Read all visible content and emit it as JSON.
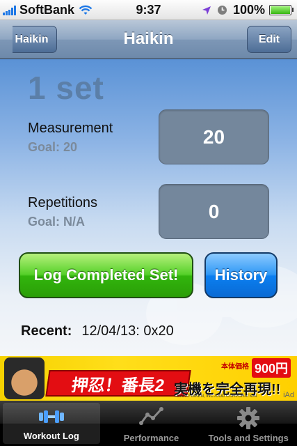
{
  "status_bar": {
    "carrier": "SoftBank",
    "time": "9:37",
    "battery": "100%"
  },
  "nav": {
    "back_label": "Haikin",
    "title": "Haikin",
    "edit_label": "Edit"
  },
  "workout": {
    "set_label": "1 set",
    "measurement": {
      "label": "Measurement",
      "goal": "Goal: 20",
      "value": "20"
    },
    "repetitions": {
      "label": "Repetitions",
      "goal": "Goal: N/A",
      "value": "0"
    },
    "log_button": "Log Completed Set!",
    "history_button": "History",
    "recent_label": "Recent:",
    "recent_value": "12/04/13: 0x20"
  },
  "ad": {
    "title": "押忍！番長2",
    "price_tag": "本体価格",
    "price": "900円",
    "subtitle": "実機を完全再現!!",
    "copyright": "©DAITO GIKEN, INC./DOD CORPORATION",
    "iad": "iAd"
  },
  "tabs": [
    {
      "label": "Workout Log",
      "icon": "dumbbell-icon",
      "active": true
    },
    {
      "label": "Performance",
      "icon": "line-chart-icon",
      "active": false
    },
    {
      "label": "Tools and Settings",
      "icon": "gear-icon",
      "active": false
    }
  ],
  "colors": {
    "log_button": "#32b50d",
    "history_button": "#0b7ff0",
    "value_box": "#74879c"
  }
}
